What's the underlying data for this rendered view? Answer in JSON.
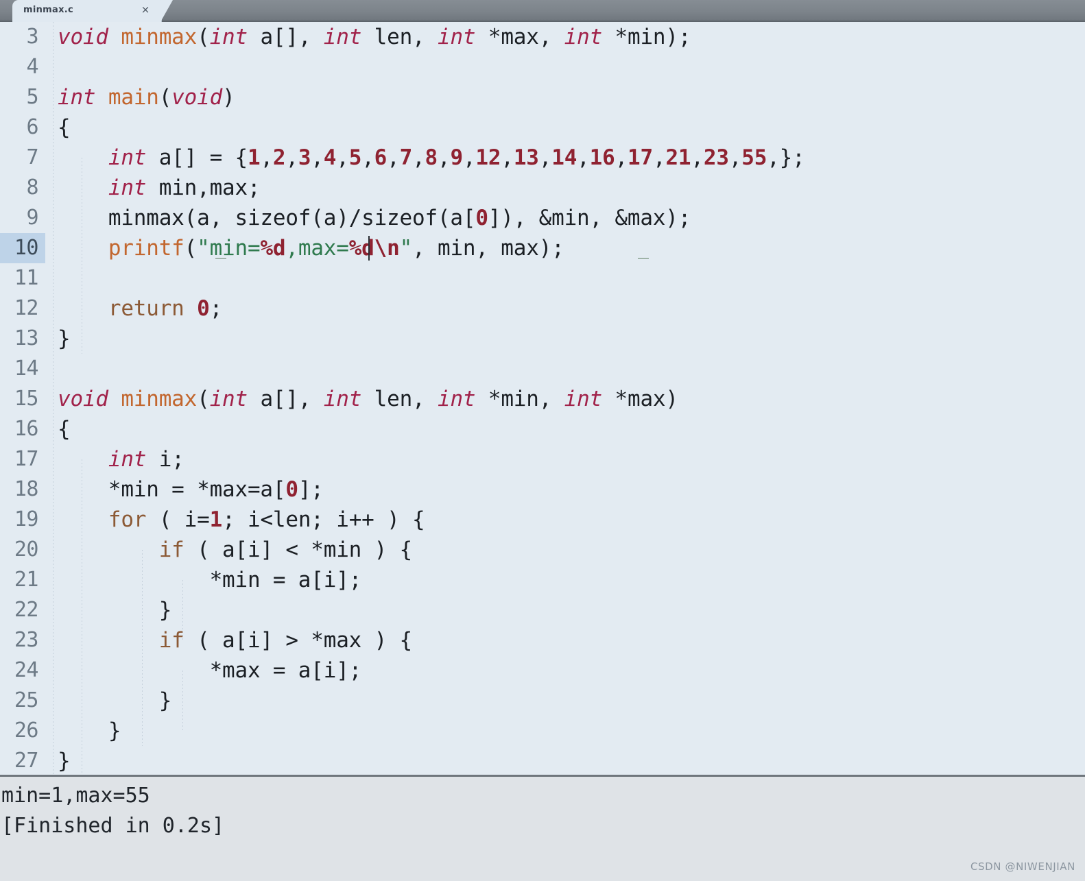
{
  "window": {
    "app_kind": "code-editor",
    "colors": {
      "chrome": "#7c838a",
      "editor_bg": "#e3ebf2",
      "active_line_gutter": "#bed3e8",
      "console_bg": "#dfe3e7",
      "keyword": "#a1224a",
      "function": "#c2662e",
      "number": "#8f2231",
      "string": "#2f7a4e",
      "control_keyword": "#8c5a36",
      "line_number": "#6d7a86",
      "text": "#1b1f24"
    }
  },
  "tabbar": {
    "tabs": [
      {
        "label": "minmax.c",
        "close_icon": "×",
        "active": true
      }
    ]
  },
  "editor": {
    "language": "c",
    "active_line": 10,
    "first_visible_line": 3,
    "last_visible_line": 27,
    "caret": {
      "line": 10,
      "column_text": "printf(\"min=%d,ma"
    },
    "lines": [
      {
        "n": "3",
        "text": "void minmax(int a[], int len, int *max, int *min);"
      },
      {
        "n": "4",
        "text": ""
      },
      {
        "n": "5",
        "text": "int main(void)"
      },
      {
        "n": "6",
        "text": "{"
      },
      {
        "n": "7",
        "text": "    int a[] = {1,2,3,4,5,6,7,8,9,12,13,14,16,17,21,23,55,};"
      },
      {
        "n": "8",
        "text": "    int min,max;"
      },
      {
        "n": "9",
        "text": "    minmax(a, sizeof(a)/sizeof(a[0]), &min, &max);"
      },
      {
        "n": "10",
        "text": "    printf(\"min=%d,max=%d\\n\", min, max);"
      },
      {
        "n": "11",
        "text": ""
      },
      {
        "n": "12",
        "text": "    return 0;"
      },
      {
        "n": "13",
        "text": "}"
      },
      {
        "n": "14",
        "text": ""
      },
      {
        "n": "15",
        "text": "void minmax(int a[], int len, int *min, int *max)"
      },
      {
        "n": "16",
        "text": "{"
      },
      {
        "n": "17",
        "text": "    int i;"
      },
      {
        "n": "18",
        "text": "    *min = *max=a[0];"
      },
      {
        "n": "19",
        "text": "    for ( i=1; i<len; i++ ) {"
      },
      {
        "n": "20",
        "text": "        if ( a[i] < *min ) {"
      },
      {
        "n": "21",
        "text": "            *min = a[i];"
      },
      {
        "n": "22",
        "text": "        }"
      },
      {
        "n": "23",
        "text": "        if ( a[i] > *max ) {"
      },
      {
        "n": "24",
        "text": "            *max = a[i];"
      },
      {
        "n": "25",
        "text": "        }"
      },
      {
        "n": "26",
        "text": "    }"
      },
      {
        "n": "27",
        "text": "}"
      }
    ]
  },
  "console": {
    "output": [
      "min=1,max=55",
      "[Finished in 0.2s]"
    ]
  },
  "watermark": {
    "text": "CSDN @NIWENJIAN"
  }
}
